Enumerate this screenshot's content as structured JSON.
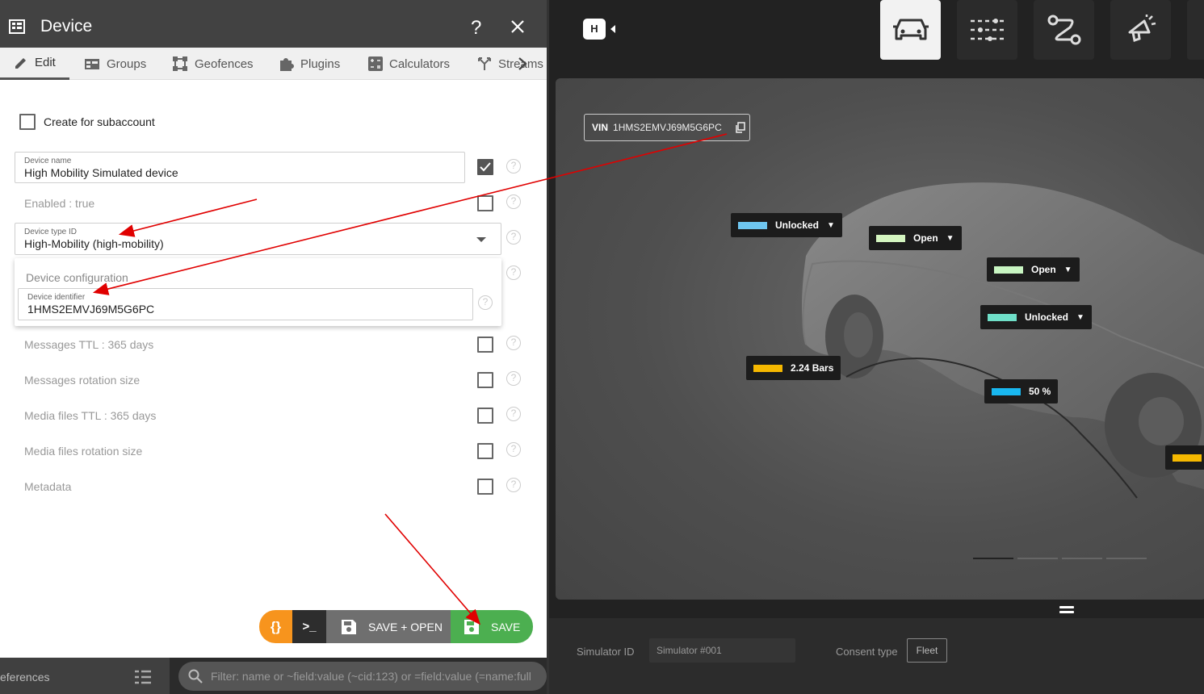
{
  "dialog": {
    "title": "Device",
    "help": "?",
    "tabs": [
      {
        "label": "Edit",
        "icon": "pencil-icon"
      },
      {
        "label": "Groups",
        "icon": "groups-icon"
      },
      {
        "label": "Geofences",
        "icon": "geofence-icon"
      },
      {
        "label": "Plugins",
        "icon": "puzzle-icon"
      },
      {
        "label": "Calculators",
        "icon": "calculator-icon"
      },
      {
        "label": "Streams",
        "icon": "streams-icon"
      }
    ],
    "create_subaccount": "Create for subaccount",
    "device_name": {
      "label": "Device name",
      "value": "High Mobility Simulated device"
    },
    "enabled": "Enabled : true",
    "device_type": {
      "label": "Device type ID",
      "value": "High-Mobility (high-mobility)"
    },
    "config": {
      "title": "Device configuration",
      "identifier_label": "Device identifier",
      "identifier_value": "1HMS2EMVJ69M5G6PC"
    },
    "rows": [
      "Messages TTL : 365 days",
      "Messages rotation size",
      "Media files TTL : 365 days",
      "Media files rotation size",
      "Metadata"
    ],
    "actions": {
      "json": "{}",
      "terminal": ">_",
      "save_open": "SAVE + OPEN",
      "save": "SAVE"
    }
  },
  "footer": {
    "left_text": "eferences",
    "filter_placeholder": "Filter: name or ~field:value (~cid:123) or =field:value (=name:full"
  },
  "simulator": {
    "logo": "H",
    "nav": [
      "car-icon",
      "sliders-icon",
      "route-icon",
      "horn-icon"
    ],
    "vin_key": "VIN",
    "vin_value": "1HMS2EMVJ69M5G6PC",
    "tags": [
      {
        "label": "Unlocked",
        "color": "#6ec6f0",
        "caret": "▼"
      },
      {
        "label": "Open",
        "color": "#d4f5c0",
        "caret": "▼"
      },
      {
        "label": "Open",
        "color": "#c8f5c2",
        "caret": "▼"
      },
      {
        "label": "Unlocked",
        "color": "#6fdfc8",
        "caret": "▼"
      },
      {
        "label": "2.24 Bars",
        "color": "#f5b800",
        "caret": ""
      },
      {
        "label": "50 %",
        "color": "#19b8f0",
        "caret": ""
      },
      {
        "label": "",
        "color": "#f5b800",
        "caret": ""
      }
    ],
    "simulator_id_label": "Simulator ID",
    "simulator_id_value": "Simulator #001",
    "consent_label": "Consent type",
    "consent_value": "Fleet"
  },
  "colors": {
    "title_bar": "#424242",
    "save_green": "#4caf50",
    "json_orange": "#f7941d",
    "arrow_red": "#e00000"
  }
}
